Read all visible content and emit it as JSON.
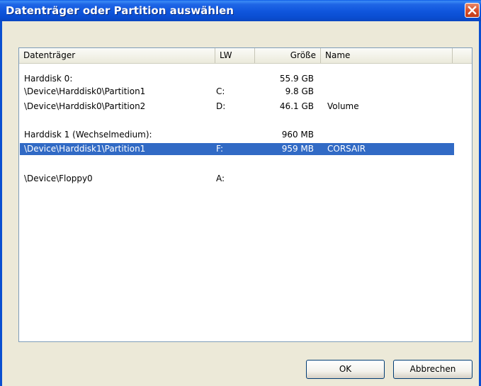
{
  "window": {
    "title": "Datenträger oder Partition auswählen"
  },
  "columns": {
    "disk": "Datenträger",
    "lw": "LW",
    "size": "Größe",
    "name": "Name"
  },
  "rows": [
    {
      "disk": "Harddisk 0:",
      "lw": "",
      "size": "55.9 GB",
      "name": ""
    },
    {
      "disk": "\\Device\\Harddisk0\\Partition1",
      "lw": "C:",
      "size": "9.8 GB",
      "name": ""
    },
    {
      "disk": "\\Device\\Harddisk0\\Partition2",
      "lw": "D:",
      "size": "46.1 GB",
      "name": "Volume"
    },
    {
      "disk": "Harddisk 1 (Wechselmedium):",
      "lw": "",
      "size": "960 MB",
      "name": ""
    },
    {
      "disk": "\\Device\\Harddisk1\\Partition1",
      "lw": "F:",
      "size": "959 MB",
      "name": "CORSAIR"
    },
    {
      "disk": "\\Device\\Floppy0",
      "lw": "A:",
      "size": "",
      "name": ""
    }
  ],
  "buttons": {
    "ok": "OK",
    "cancel": "Abbrechen"
  }
}
